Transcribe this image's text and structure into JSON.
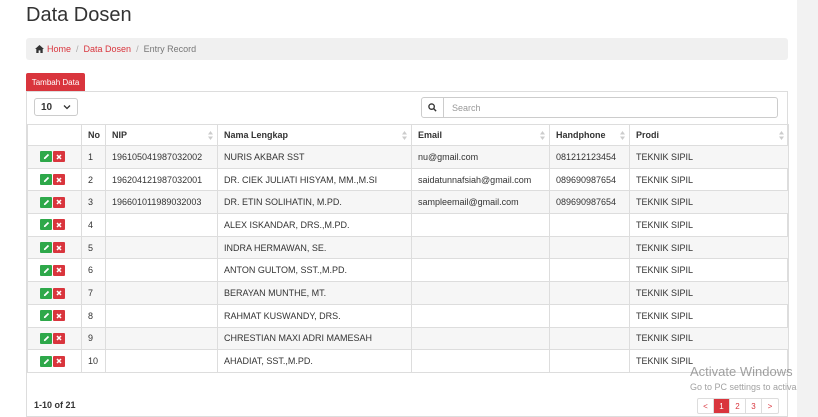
{
  "page": {
    "title": "Data Dosen"
  },
  "breadcrumb": {
    "home": "Home",
    "section": "Data Dosen",
    "current": "Entry Record",
    "separator": "/"
  },
  "toolbar": {
    "add_button": "Tambah Data",
    "per_page": "10",
    "search_placeholder": "Search"
  },
  "table": {
    "columns": {
      "no": "No",
      "nip": "NIP",
      "nama": "Nama Lengkap",
      "email": "Email",
      "handphone": "Handphone",
      "prodi": "Prodi"
    },
    "rows": [
      {
        "no": "1",
        "nip": "196105041987032002",
        "nama": "NURIS AKBAR SST",
        "email": "nu@gmail.com",
        "handphone": "081212123454",
        "prodi": "TEKNIK SIPIL"
      },
      {
        "no": "2",
        "nip": "196204121987032001",
        "nama": "DR. CIEK JULIATI HISYAM, MM.,M.SI",
        "email": "saidatunnafsiah@gmail.com",
        "handphone": "089690987654",
        "prodi": "TEKNIK SIPIL"
      },
      {
        "no": "3",
        "nip": "196601011989032003",
        "nama": "DR. ETIN SOLIHATIN, M.PD.",
        "email": "sampleemail@gmail.com",
        "handphone": "089690987654",
        "prodi": "TEKNIK SIPIL"
      },
      {
        "no": "4",
        "nip": "",
        "nama": "ALEX ISKANDAR, DRS.,M.PD.",
        "email": "",
        "handphone": "",
        "prodi": "TEKNIK SIPIL"
      },
      {
        "no": "5",
        "nip": "",
        "nama": "INDRA HERMAWAN, SE.",
        "email": "",
        "handphone": "",
        "prodi": "TEKNIK SIPIL"
      },
      {
        "no": "6",
        "nip": "",
        "nama": "ANTON GULTOM, SST.,M.PD.",
        "email": "",
        "handphone": "",
        "prodi": "TEKNIK SIPIL"
      },
      {
        "no": "7",
        "nip": "",
        "nama": "BERAYAN MUNTHE, MT.",
        "email": "",
        "handphone": "",
        "prodi": "TEKNIK SIPIL"
      },
      {
        "no": "8",
        "nip": "",
        "nama": "RAHMAT KUSWANDY, DRS.",
        "email": "",
        "handphone": "",
        "prodi": "TEKNIK SIPIL"
      },
      {
        "no": "9",
        "nip": "",
        "nama": "CHRESTIAN MAXI ADRI MAMESAH",
        "email": "",
        "handphone": "",
        "prodi": "TEKNIK SIPIL"
      },
      {
        "no": "10",
        "nip": "",
        "nama": "AHADIAT, SST.,M.PD.",
        "email": "",
        "handphone": "",
        "prodi": "TEKNIK SIPIL"
      }
    ]
  },
  "footer": {
    "count": "1-10 of 21",
    "pages": [
      "1",
      "2",
      "3"
    ],
    "prev": "<",
    "next": ">"
  },
  "watermark": {
    "line1": "Activate Windows",
    "line2": "Go to PC settings to activa"
  },
  "colors": {
    "accent": "#d9353d",
    "edit": "#2ea84a"
  },
  "icons": [
    "home-icon",
    "chevron-down-icon",
    "search-icon",
    "sort-icon",
    "edit-icon",
    "delete-icon"
  ]
}
